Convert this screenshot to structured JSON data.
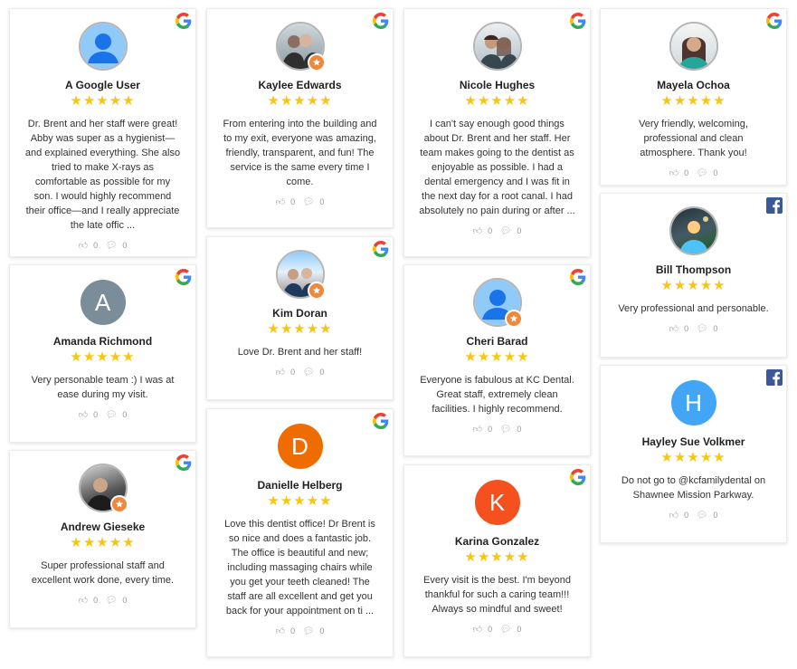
{
  "colors": {
    "star": "#f7c611",
    "badge": "#f0883c",
    "facebook": "#3b5998"
  },
  "reviews": [
    {
      "name": "A Google User",
      "text": "Dr. Brent and her staff were great! Abby was super as a hygienist—and explained everything. She also tried to make X-rays as comfortable as possible for my son. I would highly recommend their office—and I really appreciate the late offic ...",
      "likes": "0",
      "comments": "0",
      "source": "google",
      "avatar": "generic-blue"
    },
    {
      "name": "Amanda Richmond",
      "text": "Very personable team :) I was at ease during my visit.",
      "likes": "0",
      "comments": "0",
      "source": "google",
      "avatar": "letter",
      "letter": "A",
      "avatar_color": "#7a8d98"
    },
    {
      "name": "Andrew Gieseke",
      "text": "Super professional staff and excellent work done, every time.",
      "likes": "0",
      "comments": "0",
      "source": "google",
      "avatar": "photo"
    },
    {
      "name": "Kaylee Edwards",
      "text": "From entering into the building and to my exit, everyone was amazing, friendly, transparent, and fun! The service is the same every time I come.",
      "likes": "0",
      "comments": "0",
      "source": "google",
      "avatar": "photo"
    },
    {
      "name": "Kim Doran",
      "text": "Love Dr. Brent and her staff!",
      "likes": "0",
      "comments": "0",
      "source": "google",
      "avatar": "photo"
    },
    {
      "name": "Danielle Helberg",
      "text": "Love this dentist office! Dr Brent is so nice and does a fantastic job. The office is beautiful and new; including massaging chairs while you get your teeth cleaned! The staff are all excellent and get you back for your appointment on ti ...",
      "likes": "0",
      "comments": "0",
      "source": "google",
      "avatar": "letter",
      "letter": "D",
      "avatar_color": "#ef6c00"
    },
    {
      "name": "Nicole Hughes",
      "text": "I can't say enough good things about Dr. Brent and her staff. Her team makes going to the dentist as enjoyable as possible. I had a dental emergency and I was fit in the next day for a root canal. I had absolutely no pain during or after ...",
      "likes": "0",
      "comments": "0",
      "source": "google",
      "avatar": "photo"
    },
    {
      "name": "Cheri Barad",
      "text": "Everyone is fabulous at KC Dental. Great staff, extremely clean facilities. I highly recommend.",
      "likes": "0",
      "comments": "0",
      "source": "google",
      "avatar": "generic-blue"
    },
    {
      "name": "Karina Gonzalez",
      "text": "Every visit is the best. I'm beyond thankful for such a caring team!!! Always so mindful and sweet!",
      "likes": "0",
      "comments": "0",
      "source": "google",
      "avatar": "letter",
      "letter": "K",
      "avatar_color": "#f4511e"
    },
    {
      "name": "Mayela Ochoa",
      "text": "Very friendly, welcoming, professional and clean atmosphere. Thank you!",
      "likes": "0",
      "comments": "0",
      "source": "google",
      "avatar": "photo"
    },
    {
      "name": "Bill Thompson",
      "text": "Very professional and personable.",
      "likes": "0",
      "comments": "0",
      "source": "facebook",
      "avatar": "photo"
    },
    {
      "name": "Hayley Sue Volkmer",
      "text": "Do not go to @kcfamilydental on Shawnee Mission Parkway.",
      "likes": "0",
      "comments": "0",
      "source": "facebook",
      "avatar": "letter",
      "letter": "H",
      "avatar_color": "#42a5f5"
    }
  ]
}
